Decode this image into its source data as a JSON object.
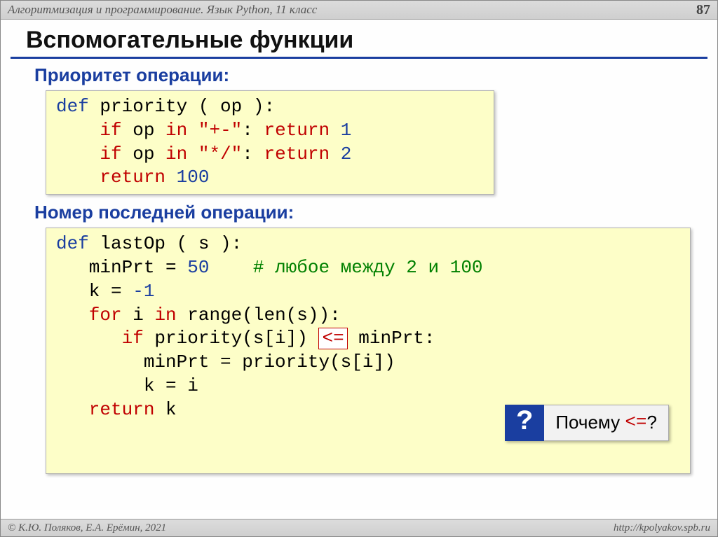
{
  "topbar": {
    "course": "Алгоритмизация и программирование. Язык Python, 11 класс",
    "page": "87"
  },
  "title": "Вспомогательные функции",
  "sect1": "Приоритет операции:",
  "code1": {
    "l1a": "def",
    "l1b": " priority ( op ):",
    "l2a": "    if",
    "l2b": " op ",
    "l2c": "in",
    "l2d": " ",
    "l2e": "\"+-\"",
    "l2f": ": ",
    "l2g": "return",
    "l2h": " ",
    "l2i": "1",
    "l3a": "    if",
    "l3b": " op ",
    "l3c": "in",
    "l3d": " ",
    "l3e": "\"*/\"",
    "l3f": ": ",
    "l3g": "return",
    "l3h": " ",
    "l3i": "2",
    "l4a": "    return",
    "l4b": " ",
    "l4c": "100"
  },
  "sect2": "Номер последней операции:",
  "code2": {
    "l1a": "def",
    "l1b": " lastOp ( s ):",
    "l2a": "   minPrt = ",
    "l2b": "50",
    "l2c": "    ",
    "l2d": "# любое между 2 и 100",
    "l3a": "   k = ",
    "l3b": "-1",
    "l4a": "   for",
    "l4b": " i ",
    "l4c": "in",
    "l4d": " range(len(s)):",
    "l5a": "      if",
    "l5b": " priority(s[i]) ",
    "l5c": "<=",
    "l5d": " minPrt:",
    "l6": "        minPrt = priority(s[i])",
    "l7": "        k = i",
    "l8a": "   return",
    "l8b": " k"
  },
  "callout": {
    "mark": "?",
    "text_a": "Почему ",
    "text_b": "<=",
    "text_c": "?"
  },
  "footer": {
    "left": "© К.Ю. Поляков, Е.А. Ерёмин, 2021",
    "right": "http://kpolyakov.spb.ru"
  }
}
